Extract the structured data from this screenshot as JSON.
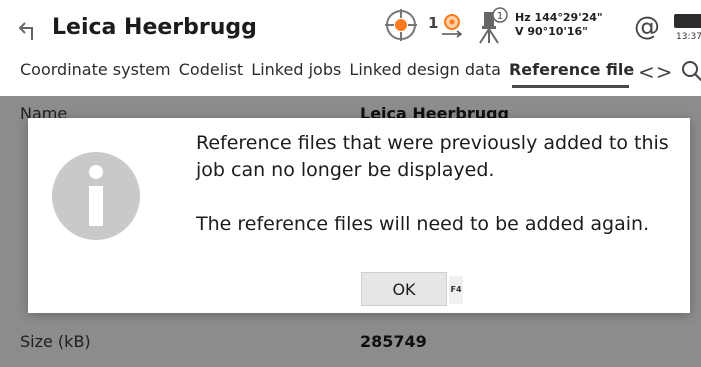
{
  "header": {
    "title": "Leica Heerbrugg",
    "target_count": "1",
    "hz": "Hz 144°29'24\"",
    "v": "V  90°10'16\"",
    "time": "13:37"
  },
  "tabs": [
    {
      "label": "Coordinate system"
    },
    {
      "label": "Codelist"
    },
    {
      "label": "Linked jobs"
    },
    {
      "label": "Linked design data"
    },
    {
      "label": "Reference file"
    }
  ],
  "form": {
    "name_label": "Name",
    "name_value": "Leica Heerbrugg",
    "size_label": "Size (kB)",
    "size_value": "285749"
  },
  "dialog": {
    "line1": "Reference files that were previously added to this job can no longer be displayed.",
    "line2": "The reference files will need to be added again.",
    "ok_label": "OK",
    "ok_key": "F4"
  },
  "colors": {
    "accent": "#ff7a1a",
    "overlay": "#000000"
  }
}
